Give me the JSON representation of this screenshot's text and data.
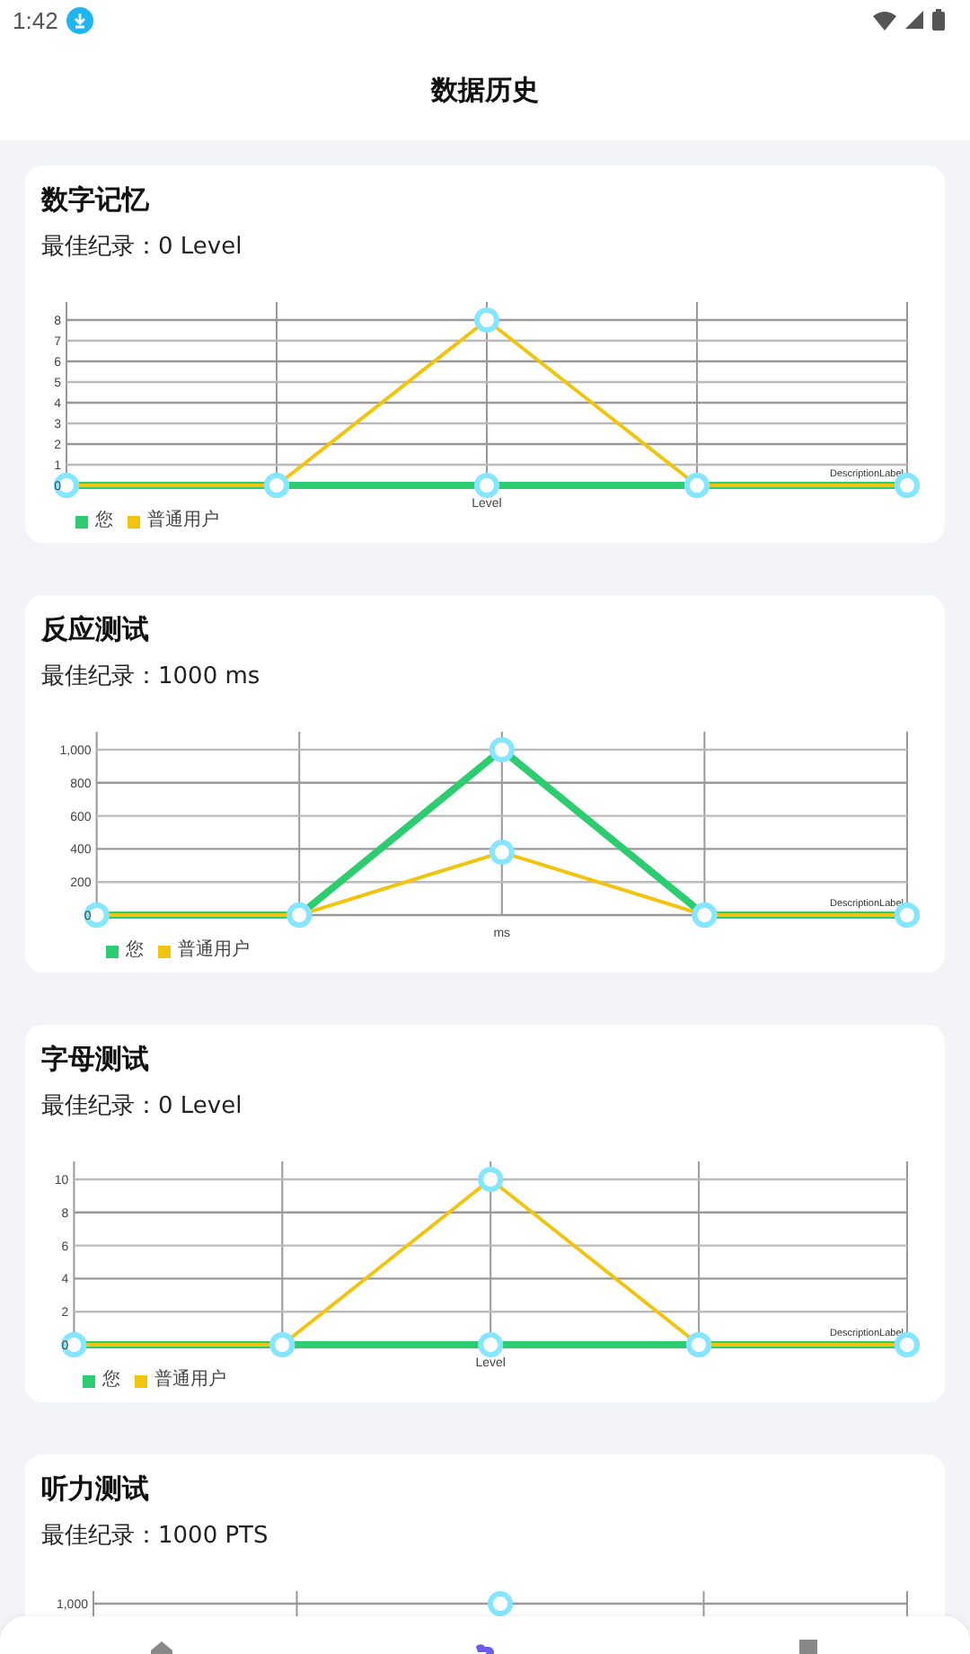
{
  "status_bar": {
    "time": "1:42"
  },
  "header": {
    "title": "数据历史"
  },
  "cards": [
    {
      "title": "数字记忆",
      "best": "最佳纪录：0 Level",
      "description_label": "DescriptionLabel",
      "chart_data": {
        "type": "line",
        "grid": true,
        "xlabel": "Level",
        "ylim": [
          0,
          8
        ],
        "yticks": [
          0,
          1,
          2,
          3,
          4,
          5,
          6,
          7,
          8
        ],
        "series": [
          {
            "name": "您",
            "color": "#2ecc71",
            "marker": true,
            "values": [
              0,
              0,
              0,
              0,
              0
            ]
          },
          {
            "name": "普通用户",
            "color": "#f1c40f",
            "marker": true,
            "values": [
              0,
              0,
              8,
              0,
              0
            ]
          }
        ]
      }
    },
    {
      "title": "反应测试",
      "best": "最佳纪录：1000 ms",
      "description_label": "DescriptionLabel",
      "chart_data": {
        "type": "line",
        "grid": true,
        "xlabel": "ms",
        "ylim": [
          0,
          1000
        ],
        "yticks": [
          0,
          200,
          400,
          600,
          800,
          {
            "value": 1000,
            "label": "1,000"
          }
        ],
        "series": [
          {
            "name": "您",
            "color": "#2ecc71",
            "marker": true,
            "values": [
              0,
              0,
              1000,
              0,
              0
            ]
          },
          {
            "name": "普通用户",
            "color": "#f1c40f",
            "marker": true,
            "values": [
              0,
              0,
              380,
              0,
              0
            ]
          }
        ]
      }
    },
    {
      "title": "字母测试",
      "best": "最佳纪录：0 Level",
      "description_label": "DescriptionLabel",
      "chart_data": {
        "type": "line",
        "grid": true,
        "xlabel": "Level",
        "ylim": [
          0,
          10
        ],
        "yticks": [
          0,
          2,
          4,
          6,
          8,
          10
        ],
        "series": [
          {
            "name": "您",
            "color": "#2ecc71",
            "marker": true,
            "values": [
              0,
              0,
              0,
              0,
              0
            ]
          },
          {
            "name": "普通用户",
            "color": "#f1c40f",
            "marker": true,
            "values": [
              0,
              0,
              10,
              0,
              0
            ]
          }
        ]
      }
    },
    {
      "title": "听力测试",
      "best": "最佳纪录：1000 PTS",
      "chart_preview": {
        "top_tick_label": "1,000"
      }
    }
  ],
  "bottom_nav": [
    {
      "kind": "home",
      "selected": false
    },
    {
      "kind": "link",
      "selected": true
    },
    {
      "kind": "note",
      "selected": false
    }
  ]
}
